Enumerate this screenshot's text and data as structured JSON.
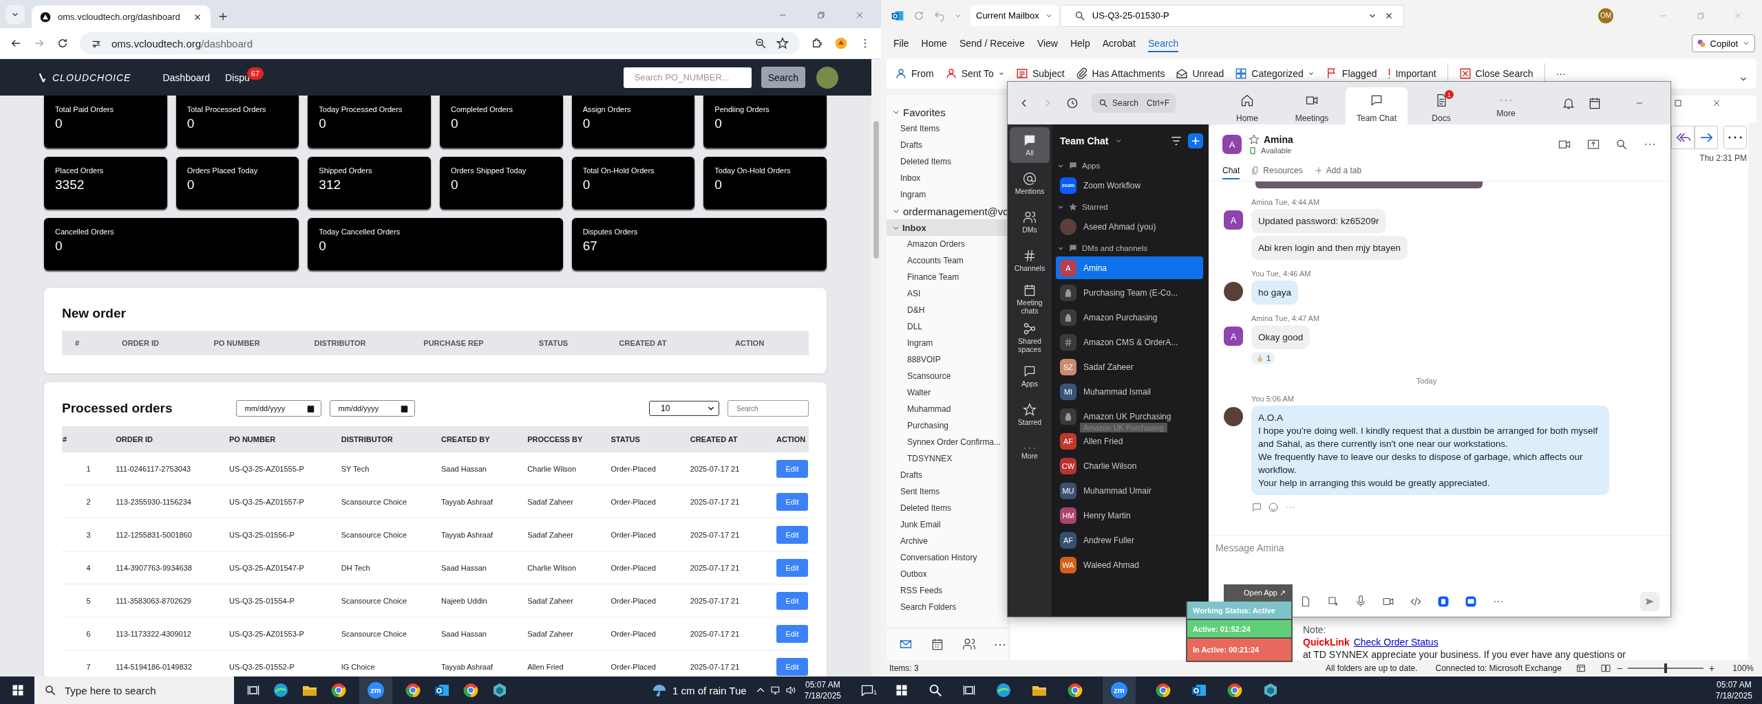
{
  "browser": {
    "tab_title": "oms.vcloudtech.org/dashboard",
    "url_host": "oms.vcloudtech.org",
    "url_path": "/dashboard"
  },
  "site_nav": {
    "logo": "CLOUDCHOICE",
    "links": [
      {
        "label": "Dashboard"
      },
      {
        "label": "Dispu",
        "badge": "67"
      }
    ],
    "search_placeholder": "Search PO_NUMBER...",
    "search_button": "Search"
  },
  "stat_rows": [
    [
      {
        "label": "Total Paid Orders",
        "value": "0"
      },
      {
        "label": "Total Processed Orders",
        "value": "0"
      },
      {
        "label": "Today Processed Orders",
        "value": "0"
      },
      {
        "label": "Completed Orders",
        "value": "0"
      },
      {
        "label": "Assign Orders",
        "value": "0"
      },
      {
        "label": "Pendiing Orders",
        "value": "0"
      }
    ],
    [
      {
        "label": "Placed Orders",
        "value": "3352"
      },
      {
        "label": "Orders Placed Today",
        "value": "0"
      },
      {
        "label": "Shipped Orders",
        "value": "312"
      },
      {
        "label": "Orders Shipped Today",
        "value": "0"
      },
      {
        "label": "Total On-Hold Orders",
        "value": "0"
      },
      {
        "label": "Today On-Hold Orders",
        "value": "0"
      }
    ],
    [
      {
        "label": "Cancelled Orders",
        "value": "0"
      },
      {
        "label": "Today Cancelled Orders",
        "value": "0"
      },
      {
        "label": "Disputes Orders",
        "value": "67"
      }
    ]
  ],
  "new_order": {
    "title": "New order",
    "columns": [
      "#",
      "ORDER ID",
      "PO NUMBER",
      "DISTRIBUTOR",
      "PURCHASE REP",
      "STATUS",
      "CREATED AT",
      "ACTION"
    ]
  },
  "processed_orders": {
    "title": "Processed orders",
    "date_placeholders": [
      "mm/dd/yyyy",
      "mm/dd/yyyy"
    ],
    "page_size": "10",
    "search_placeholder": "Search",
    "columns": [
      "#",
      "ORDER ID",
      "PO NUMBER",
      "DISTRIBUTOR",
      "CREATED BY",
      "PROCCESS BY",
      "STATUS",
      "CREATED AT",
      "ACTION"
    ],
    "rows": [
      {
        "cells": [
          "1",
          "111-0246117-2753043",
          "US-Q3-25-AZ01555-P",
          "SY Tech",
          "Saad Hassan",
          "Charlie Wilson",
          "Order-Placed",
          "2025-07-17 21"
        ],
        "action": "Edit"
      },
      {
        "cells": [
          "2",
          "113-2355930-1156234",
          "US-Q3-25-AZ01557-P",
          "Scansource Choice",
          "Tayyab Ashraaf",
          "Sadaf Zaheer",
          "Order-Placed",
          "2025-07-17 21"
        ],
        "action": "Edit"
      },
      {
        "cells": [
          "3",
          "112-1255831-5001860",
          "US-Q3-25-01556-P",
          "Scansource Choice",
          "Tayyab Ashraaf",
          "Sadaf Zaheer",
          "Order-Placed",
          "2025-07-17 21"
        ],
        "action": "Edit"
      },
      {
        "cells": [
          "4",
          "114-3907763-9934638",
          "US-Q3-25-AZ01547-P",
          "DH Tech",
          "Saad Hassan",
          "Charlie Wilson",
          "Order-Placed",
          "2025-07-17 21"
        ],
        "action": "Edit"
      },
      {
        "cells": [
          "5",
          "111-3583063-8702629",
          "US-Q3-25-01554-P",
          "Scansource Choice",
          "Najeeb Uddin",
          "Sadaf Zaheer",
          "Order-Placed",
          "2025-07-17 21"
        ],
        "action": "Edit"
      },
      {
        "cells": [
          "6",
          "113-1173322-4309012",
          "US-Q3-25-AZ01553-P",
          "Scansource Choice",
          "Saad Hassan",
          "Sadaf Zaheer",
          "Order-Placed",
          "2025-07-17 21"
        ],
        "action": "Edit"
      },
      {
        "cells": [
          "7",
          "114-5194186-0149832",
          "US-Q3-25-01552-P",
          "IG Choice",
          "Tayyab Ashraaf",
          "Allen Fried",
          "Order-Placed",
          "2025-07-17 21"
        ],
        "action": "Edit"
      }
    ]
  },
  "outlook": {
    "search_scope": "Current Mailbox",
    "search_value": "US-Q3-25-01530-P",
    "account_initials": "OM",
    "menu": [
      {
        "label": "File",
        "selected": false
      },
      {
        "label": "Home",
        "selected": false
      },
      {
        "label": "Send / Receive",
        "selected": false
      },
      {
        "label": "View",
        "selected": false
      },
      {
        "label": "Help",
        "selected": false
      },
      {
        "label": "Acrobat",
        "selected": false
      },
      {
        "label": "Search",
        "selected": true
      }
    ],
    "copilot": "Copilot",
    "ribbon": [
      {
        "label": "From",
        "dropdown": false
      },
      {
        "label": "Sent To",
        "dropdown": true
      },
      {
        "label": "Subject",
        "dropdown": false
      },
      {
        "label": "Has Attachments",
        "dropdown": false
      },
      {
        "label": "Unread",
        "dropdown": false
      },
      {
        "label": "Categorized",
        "dropdown": true
      },
      {
        "label": "Flagged",
        "dropdown": false
      },
      {
        "label": "Important",
        "dropdown": false
      },
      {
        "label": "Close Search",
        "dropdown": false
      }
    ],
    "ribbon_more": "···",
    "folders": [
      {
        "label": "Favorites",
        "expanded": true,
        "selected": false,
        "children": [
          {
            "label": "Sent Items",
            "selected": false
          },
          {
            "label": "Drafts",
            "selected": false
          },
          {
            "label": "Deleted Items",
            "selected": false
          },
          {
            "label": "Inbox",
            "selected": false
          },
          {
            "label": "Ingram",
            "selected": false
          }
        ]
      },
      {
        "label": "ordermanagement@vc",
        "expanded": true,
        "selected": false,
        "children": [
          {
            "label": "Inbox",
            "expanded": true,
            "selected": true,
            "children": [
              {
                "label": "Amazon Orders",
                "selected": false
              },
              {
                "label": "Accounts Team",
                "selected": false
              },
              {
                "label": "Finance Team",
                "selected": false
              },
              {
                "label": "ASI",
                "selected": false
              },
              {
                "label": "D&H",
                "selected": false
              },
              {
                "label": "DLL",
                "selected": false
              },
              {
                "label": "Ingram",
                "selected": false
              },
              {
                "label": "888VOIP",
                "selected": false
              },
              {
                "label": "Scansource",
                "selected": false
              },
              {
                "label": "Walter",
                "selected": false
              },
              {
                "label": "Muhammad",
                "selected": false
              },
              {
                "label": "Purchasing",
                "selected": false
              },
              {
                "label": "Synnex Order Confirma...",
                "selected": false
              },
              {
                "label": "TDSYNNEX",
                "selected": false
              }
            ]
          },
          {
            "label": "Drafts",
            "selected": false
          },
          {
            "label": "Sent Items",
            "selected": false
          },
          {
            "label": "Deleted Items",
            "selected": false
          },
          {
            "label": "Junk Email",
            "selected": false
          },
          {
            "label": "Archive",
            "selected": false
          },
          {
            "label": "Conversation History",
            "selected": false
          },
          {
            "label": "Outbox",
            "selected": false
          },
          {
            "label": "RSS Feeds",
            "selected": false
          },
          {
            "label": "Search Folders",
            "selected": false
          }
        ]
      }
    ],
    "nav_more": "···",
    "message_date": "Thu 2:31 PM",
    "note_label": "Note:",
    "quicklink_label": "QuickLink",
    "quicklink": "Check Order Status",
    "body_fragment": "at TD SYNNEX appreciate your business. If you ever have any questions or",
    "zoom_slider": {
      "minus": "−",
      "plus": "+",
      "level": 0.5
    },
    "status_items": "Items: 3",
    "status_sync": "All folders are up to date.",
    "status_connection": "Connected to: Microsoft Exchange",
    "zoom_level": "100%"
  },
  "zoom": {
    "search_placeholder": "Search",
    "search_shortcut": "Ctrl+F",
    "tabs": [
      {
        "label": "Home",
        "selected": false
      },
      {
        "label": "Meetings",
        "selected": false
      },
      {
        "label": "Team Chat",
        "selected": true
      },
      {
        "label": "Docs",
        "selected": false,
        "badge": "1"
      },
      {
        "label": "More",
        "selected": false
      }
    ],
    "rail": [
      {
        "label": "All",
        "selected": true
      },
      {
        "label": "Mentions",
        "selected": false
      },
      {
        "label": "DMs",
        "selected": false
      },
      {
        "label": "Channels",
        "selected": false
      },
      {
        "label": "Meeting chats",
        "selected": false
      },
      {
        "label": "Shared spaces",
        "selected": false
      },
      {
        "label": "Apps",
        "selected": false
      },
      {
        "label": "Starred",
        "selected": false
      },
      {
        "label": "More",
        "selected": false
      }
    ],
    "sidebar_title": "Team Chat",
    "sections": [
      {
        "label": "Apps",
        "expanded": true,
        "items": [
          {
            "name": "Zoom Workflow",
            "kind": "app",
            "text": "zoom",
            "selected": false
          }
        ]
      },
      {
        "label": "Starred",
        "expanded": true,
        "items": [
          {
            "name": "Aseed Ahmad (you)",
            "kind": "photo",
            "selected": false
          }
        ]
      },
      {
        "label": "DMs and channels",
        "expanded": true,
        "items": [
          {
            "name": "Amina",
            "kind": "initials",
            "text": "A",
            "color": "#b5404f",
            "selected": true
          },
          {
            "name": "Purchasing Team (E-Co...",
            "kind": "lock",
            "selected": false
          },
          {
            "name": "Amazon Purchasing",
            "kind": "lock",
            "selected": false
          },
          {
            "name": "Amazon CMS & OrderA...",
            "kind": "hash",
            "selected": false
          },
          {
            "name": "Sadaf Zaheer",
            "kind": "initials",
            "text": "SZ",
            "color": "#c98a6e",
            "selected": false
          },
          {
            "name": "Muhammad Ismail",
            "kind": "initials",
            "text": "MI",
            "color": "#3b5578",
            "selected": false
          },
          {
            "name": "Amazon UK Purchasing",
            "kind": "lock",
            "selected": false,
            "tooltip": "Amazon UK Purchasing"
          },
          {
            "name": "Allen Fried",
            "kind": "initials",
            "text": "AF",
            "color": "#c0392b",
            "selected": false
          },
          {
            "name": "Charlie Wilson",
            "kind": "initials",
            "text": "CW",
            "color": "#b83232",
            "selected": false
          },
          {
            "name": "Muhammad Umair",
            "kind": "initials",
            "text": "MU",
            "color": "#3a5172",
            "selected": false
          },
          {
            "name": "Henry Martin",
            "kind": "initials",
            "text": "HM",
            "color": "#a8446e",
            "selected": false
          },
          {
            "name": "Andrew Fuller",
            "kind": "initials",
            "text": "AF",
            "color": "#34506f",
            "selected": false
          },
          {
            "name": "Waleed Ahmad",
            "kind": "initials",
            "text": "WA",
            "color": "#d2601a",
            "selected": false
          }
        ]
      }
    ],
    "chat": {
      "avatar": "A",
      "name": "Amina",
      "status": "Available",
      "tabs": [
        {
          "label": "Chat",
          "selected": true
        },
        {
          "label": "Resources",
          "selected": false
        },
        {
          "label": "Add a tab",
          "selected": false
        }
      ],
      "groups": [
        {
          "sender": "Amina",
          "time": "Tue, 4:44 AM",
          "mine": false,
          "avatar": "A",
          "bubbles": [
            "Updated password: kz65209r",
            "Abi kren login and then mjy btayen"
          ]
        },
        {
          "sender": "You",
          "time": "Tue, 4:46 AM",
          "mine": true,
          "bubbles": [
            "ho gaya"
          ]
        },
        {
          "sender": "Amina",
          "time": "Tue, 4:47 AM",
          "mine": false,
          "avatar": "A",
          "bubbles": [
            "Okay good"
          ],
          "reaction": "1"
        },
        {
          "divider": "Today"
        },
        {
          "sender": "You",
          "time": "5:06 AM",
          "mine": true,
          "bubbles": [
            "A.O.A\nI hope you're doing well. I kindly request that a dustbin be arranged for both myself and Sahal, as there currently isn't one near our workstations.\nWe frequently have to leave our desks to dispose of garbage, which affects our workflow.\nYour help in arranging this would be greatly appreciated."
          ]
        }
      ],
      "composer_placeholder": "Message Amina"
    }
  },
  "status_widget": {
    "open_app": "Open App ↗",
    "working_status": "Working Status: Active",
    "active": "Active: 01:52:24",
    "inactive": "In Active: 00:21:24"
  },
  "taskbar_left": {
    "search_placeholder": "Type here to search",
    "zoom_app": "zm",
    "weather": "1 cm of rain Tue",
    "time": "05:07 AM",
    "date": "7/18/2025",
    "notifications": "1"
  },
  "taskbar_right": {
    "zoom_app": "zm",
    "time": "05:07 AM",
    "date": "7/18/2025"
  }
}
